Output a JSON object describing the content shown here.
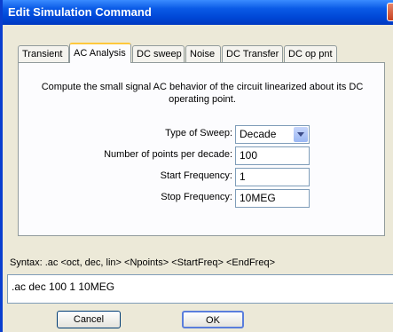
{
  "window": {
    "title": "Edit Simulation Command"
  },
  "tabs": [
    {
      "label": "Transient"
    },
    {
      "label": "AC Analysis"
    },
    {
      "label": "DC sweep"
    },
    {
      "label": "Noise"
    },
    {
      "label": "DC Transfer"
    },
    {
      "label": "DC op pnt"
    }
  ],
  "active_tab": "AC Analysis",
  "ac": {
    "description": "Compute the small signal AC behavior of the circuit linearized about its DC operating point.",
    "sweep_label": "Type of Sweep:",
    "sweep_value": "Decade",
    "points_label": "Number of points per decade:",
    "points_value": "100",
    "start_label": "Start Frequency:",
    "start_value": "1",
    "stop_label": "Stop Frequency:",
    "stop_value": "10MEG"
  },
  "syntax": "Syntax:  .ac <oct, dec, lin> <Npoints> <StartFreq> <EndFreq>",
  "command": ".ac dec 100 1 10MEG",
  "buttons": {
    "cancel": "Cancel",
    "ok": "OK"
  }
}
